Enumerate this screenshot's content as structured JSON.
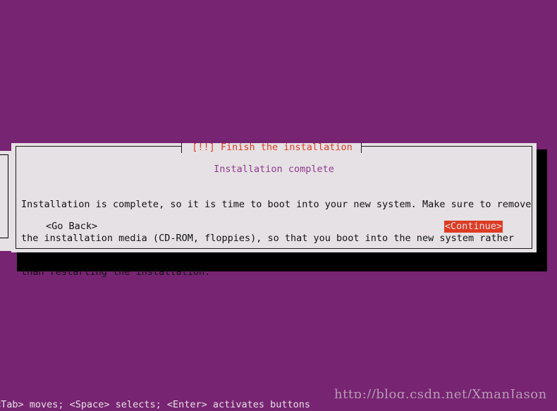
{
  "colors": {
    "background_purple": "#772472",
    "dialog_background": "#E6E1E4",
    "title_red": "#DD3B24",
    "subtitle_purple": "#8E3A8E",
    "body_text": "#111111",
    "shadow": "#000000",
    "status_text": "#E6E1E4",
    "watermark": "#C3B0C0"
  },
  "dialog": {
    "title": "[!!] Finish the installation",
    "subtitle": "Installation complete",
    "body_lines": [
      "Installation is complete, so it is time to boot into your new system. Make sure to remove",
      "the installation media (CD-ROM, floppies), so that you boot into the new system rather",
      "than restarting the installation."
    ],
    "buttons": {
      "back": "<Go Back>",
      "continue": "<Continue>"
    }
  },
  "status_bar": {
    "text": "<Tab> moves; <Space> selects; <Enter> activates buttons"
  },
  "watermark": {
    "text": "http://blog.csdn.net/XmanJason"
  }
}
